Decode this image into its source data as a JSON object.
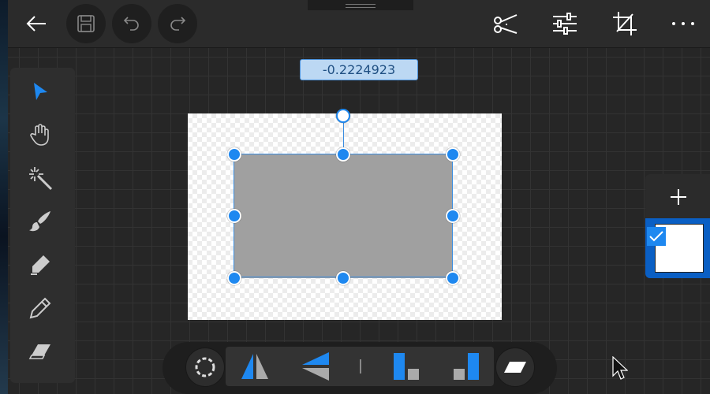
{
  "header": {
    "back_icon": "arrow-left-icon",
    "save_icon": "floppy-save-icon",
    "undo_icon": "undo-icon",
    "redo_icon": "redo-icon",
    "cut_icon": "scissors-icon",
    "adjust_icon": "sliders-icon",
    "crop_icon": "crop-icon",
    "more_icon": "more-horizontal-icon"
  },
  "value_readout": "-0.2224923",
  "tools": [
    {
      "name": "select",
      "icon": "pointer-arrow-icon",
      "active": true
    },
    {
      "name": "pan",
      "icon": "hand-icon"
    },
    {
      "name": "magic-wand",
      "icon": "magic-wand-icon"
    },
    {
      "name": "brush",
      "icon": "brush-icon"
    },
    {
      "name": "marker",
      "icon": "marker-icon"
    },
    {
      "name": "pencil",
      "icon": "pencil-icon"
    },
    {
      "name": "eraser",
      "icon": "eraser-icon"
    }
  ],
  "layers": {
    "add_icon": "plus-icon",
    "selected": true
  },
  "bottom_toolbar": {
    "items": [
      "rotate-icon",
      "flip-horizontal-icon",
      "flip-vertical-icon",
      "align-bottom-left-icon",
      "align-bottom-right-icon",
      "skew-icon"
    ]
  },
  "colors": {
    "accent": "#1e88f0",
    "canvas_shape": "#a0a0a0",
    "value_bg": "#bcd8f3",
    "layer_selected": "#0a5fc4"
  }
}
